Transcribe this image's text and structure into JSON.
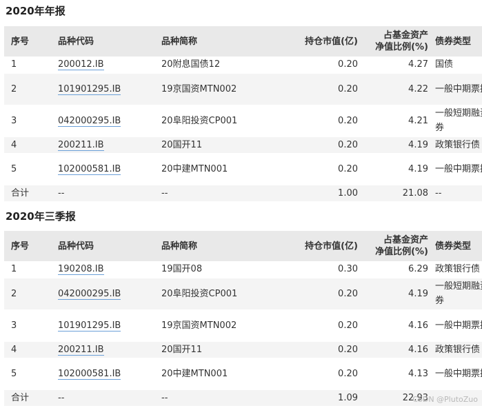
{
  "columns": [
    "序号",
    "品种代码",
    "品种简称",
    "持仓市值(亿)",
    "占基金资产\n净值比例(%)",
    "债券类型"
  ],
  "sections": [
    {
      "title": "2020年年报",
      "rows": [
        {
          "no": "1",
          "code": "200012.IB",
          "name": "20附息国债12",
          "value": "0.20",
          "ratio": "4.27",
          "type": "国债"
        },
        {
          "no": "2",
          "code": "101901295.IB",
          "name": "19京国资MTN002",
          "value": "0.20",
          "ratio": "4.22",
          "type": "一般中期票据"
        },
        {
          "no": "3",
          "code": "042000295.IB",
          "name": "20阜阳投资CP001",
          "value": "0.20",
          "ratio": "4.21",
          "type": "一般短期融资券"
        },
        {
          "no": "4",
          "code": "200211.IB",
          "name": "20国开11",
          "value": "0.20",
          "ratio": "4.19",
          "type": "政策银行债"
        },
        {
          "no": "5",
          "code": "102000581.IB",
          "name": "20中建MTN001",
          "value": "0.20",
          "ratio": "4.19",
          "type": "一般中期票据"
        }
      ],
      "total": {
        "no": "合计",
        "code": "--",
        "name": "--",
        "value": "1.00",
        "ratio": "21.08",
        "type": "--"
      }
    },
    {
      "title": "2020年三季报",
      "rows": [
        {
          "no": "1",
          "code": "190208.IB",
          "name": "19国开08",
          "value": "0.30",
          "ratio": "6.29",
          "type": "政策银行债"
        },
        {
          "no": "2",
          "code": "042000295.IB",
          "name": "20阜阳投资CP001",
          "value": "0.20",
          "ratio": "4.19",
          "type": "一般短期融资券"
        },
        {
          "no": "3",
          "code": "101901295.IB",
          "name": "19京国资MTN002",
          "value": "0.20",
          "ratio": "4.16",
          "type": "一般中期票据"
        },
        {
          "no": "4",
          "code": "200211.IB",
          "name": "20国开11",
          "value": "0.20",
          "ratio": "4.16",
          "type": "政策银行债"
        },
        {
          "no": "5",
          "code": "102000581.IB",
          "name": "20中建MTN001",
          "value": "0.20",
          "ratio": "4.13",
          "type": "一般中期票据"
        }
      ],
      "total": {
        "no": "合计",
        "code": "--",
        "name": "--",
        "value": "1.09",
        "ratio": "22.93",
        "type": ""
      }
    }
  ],
  "watermark": "CSDN @PlutoZuo",
  "colors": {
    "header_bg": "#e9e9e9",
    "stripe_bg": "#f4f4f4",
    "link_underline": "#6a9fd8"
  }
}
